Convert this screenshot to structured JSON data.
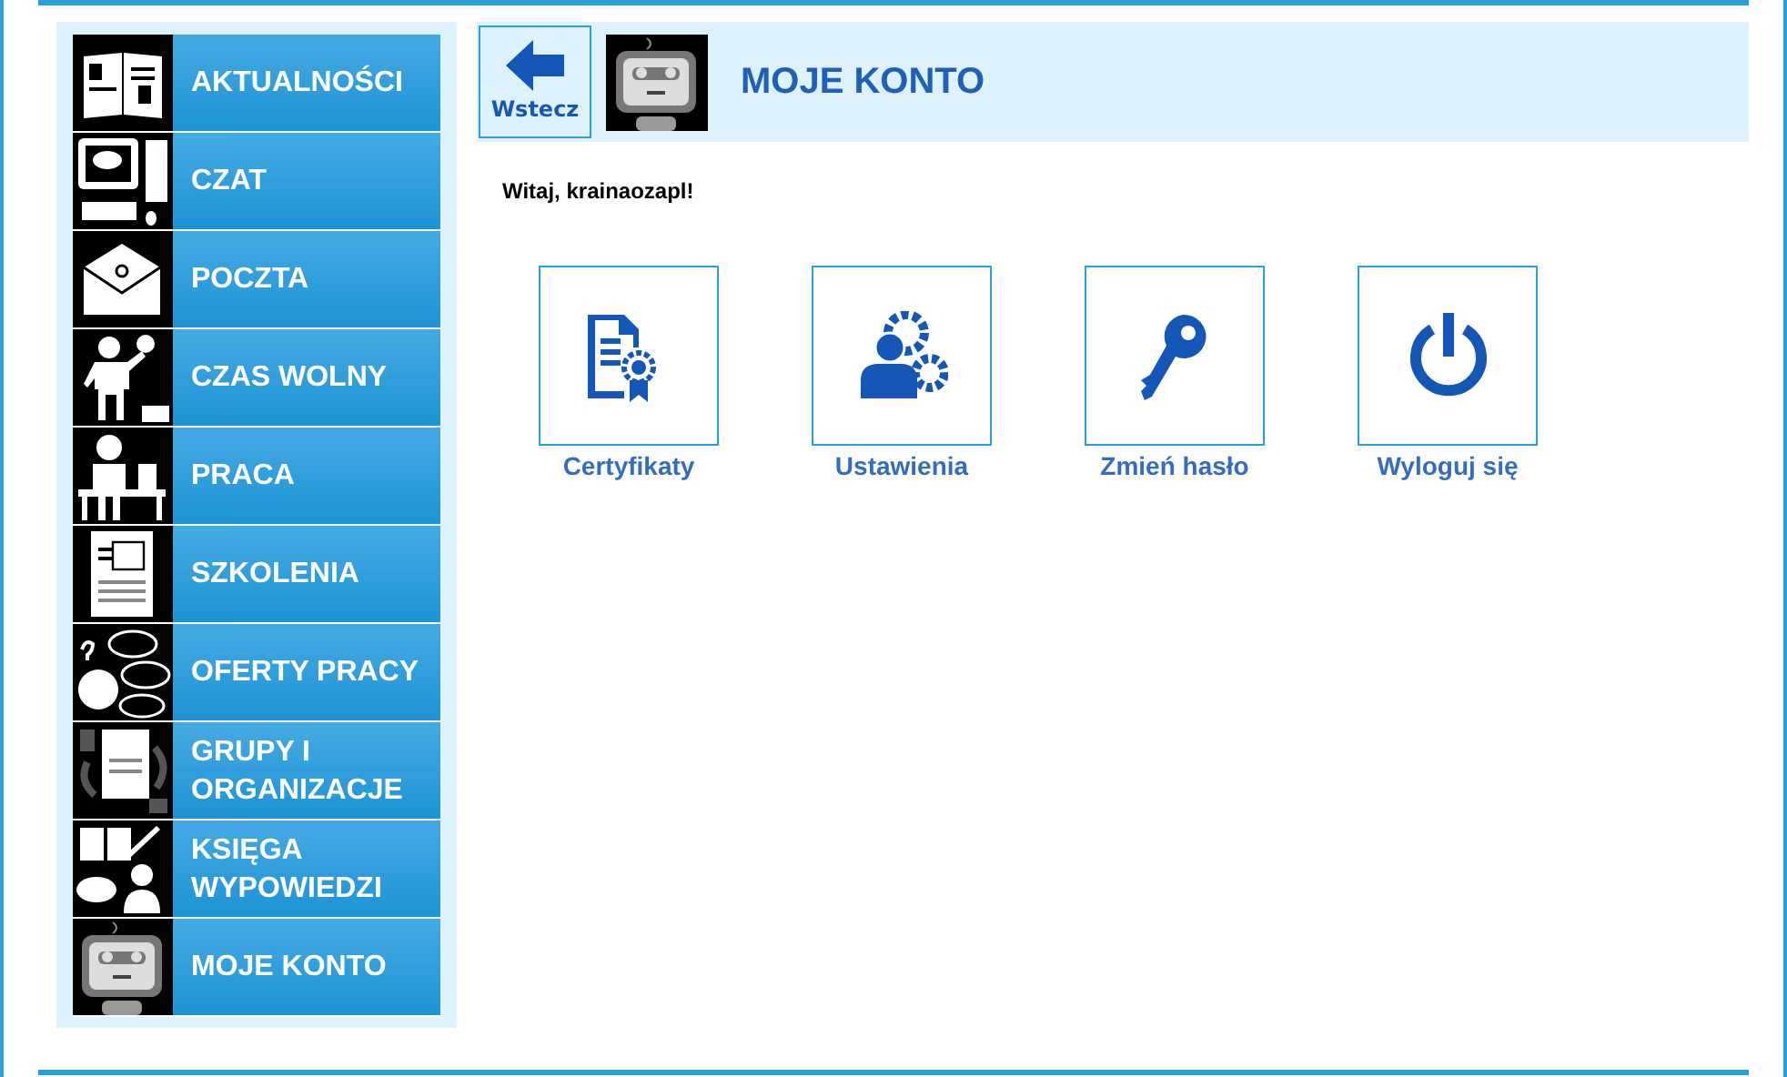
{
  "sidebar": {
    "items": [
      {
        "label": "AKTUALNOŚCI"
      },
      {
        "label": "CZAT"
      },
      {
        "label": "POCZTA"
      },
      {
        "label": "CZAS WOLNY"
      },
      {
        "label": "PRACA"
      },
      {
        "label": "SZKOLENIA"
      },
      {
        "label": "OFERTY PRACY"
      },
      {
        "label": "GRUPY I ORGANIZACJE"
      },
      {
        "label": "KSIĘGA WYPOWIEDZI"
      },
      {
        "label": "MOJE KONTO"
      }
    ]
  },
  "header": {
    "back_button": "Wstecz",
    "title": "MOJE KONTO"
  },
  "greeting": "Witaj, krainaozapl!",
  "tiles": [
    {
      "label": "Certyfikaty"
    },
    {
      "label": "Ustawienia"
    },
    {
      "label": "Zmień hasło"
    },
    {
      "label": "Wyloguj się"
    }
  ]
}
